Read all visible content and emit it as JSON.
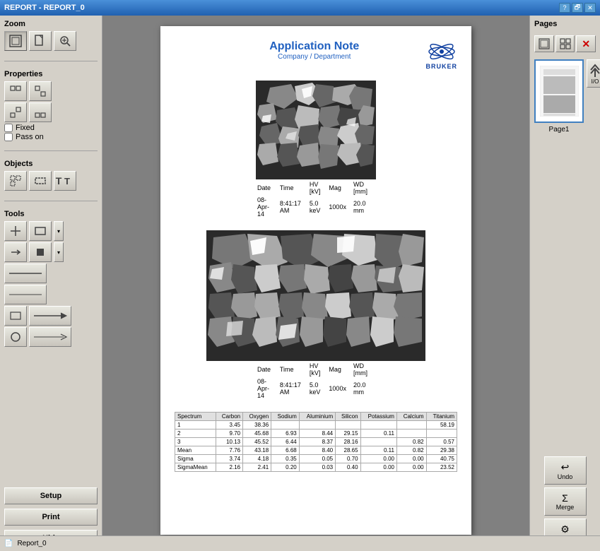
{
  "titleBar": {
    "title": "REPORT - REPORT_0",
    "helpBtn": "?",
    "restoreBtn": "🗗",
    "closeBtn": "✕"
  },
  "leftPanel": {
    "zoom": {
      "label": "Zoom",
      "buttons": [
        {
          "name": "zoom-fit",
          "icon": "⊡"
        },
        {
          "name": "zoom-page",
          "icon": "▣"
        },
        {
          "name": "zoom-in",
          "icon": "⊕"
        }
      ]
    },
    "properties": {
      "label": "Properties",
      "buttons": [
        {
          "name": "prop-1",
          "icon": "⊞"
        },
        {
          "name": "prop-2",
          "icon": "⊟"
        },
        {
          "name": "prop-3",
          "icon": "⊠"
        },
        {
          "name": "prop-4",
          "icon": "⊡"
        }
      ]
    },
    "fixed": {
      "label": "Fixed"
    },
    "passOn": {
      "label": "Pass on"
    },
    "objects": {
      "label": "Objects",
      "buttons": [
        {
          "name": "obj-select",
          "icon": "⊹"
        },
        {
          "name": "obj-rect",
          "icon": "▭"
        },
        {
          "name": "obj-text",
          "icon": "T"
        }
      ]
    },
    "tools": {
      "label": "Tools",
      "row1": [
        {
          "name": "tool-move",
          "icon": "✛"
        },
        {
          "name": "tool-rect",
          "icon": "▭"
        },
        {
          "name": "tool-dropdown1",
          "icon": "▾"
        }
      ],
      "row2": [
        {
          "name": "tool-arrow",
          "icon": "→"
        },
        {
          "name": "tool-dot",
          "icon": "■"
        },
        {
          "name": "tool-dropdown2",
          "icon": "▾"
        }
      ],
      "row3": [
        {
          "name": "tool-hline",
          "icon": "—"
        }
      ],
      "row4": [
        {
          "name": "tool-line1",
          "icon": "—"
        }
      ],
      "row5": [
        {
          "name": "tool-frame",
          "icon": "☐"
        },
        {
          "name": "tool-arrow2",
          "icon": "→"
        }
      ],
      "row6": [
        {
          "name": "tool-circle",
          "icon": "○"
        },
        {
          "name": "tool-arrow3",
          "icon": "→"
        }
      ]
    },
    "setupBtn": "Setup",
    "printBtn": "Print",
    "hideBtn": "Hide"
  },
  "document": {
    "header": {
      "title": "Application Note",
      "subtitle": "Company / Department",
      "logoText": "BRUKER"
    },
    "image1": {
      "meta": {
        "dateLabel": "Date",
        "timeLabel": "Time",
        "hvLabel": "HV\n[kV]",
        "magLabel": "Mag",
        "wdLabel": "WD\n[mm]",
        "dateVal": "08-Apr-14",
        "timeVal": "8:41:17 AM",
        "hvVal": "5.0 keV",
        "magVal": "1000x",
        "wdVal": "20.0 mm"
      }
    },
    "image2": {
      "meta": {
        "dateLabel": "Date",
        "timeLabel": "Time",
        "hvLabel": "HV\n[kV]",
        "magLabel": "Mag",
        "wdLabel": "WD\n[mm]",
        "dateVal": "08-Apr-14",
        "timeVal": "8:41:17 AM",
        "hvVal": "5.0 keV",
        "magVal": "1000x",
        "wdVal": "20.0 mm"
      }
    },
    "dataTable": {
      "headers": [
        "Spectrum",
        "Carbon",
        "Oxygen",
        "Sodium",
        "Aluminium",
        "Silicon",
        "Potassium",
        "Calcium",
        "Titanium"
      ],
      "rows": [
        [
          "1",
          "3.45",
          "38.36",
          "",
          "",
          "",
          "",
          "",
          "58.19"
        ],
        [
          "2",
          "9.70",
          "45.68",
          "6.93",
          "8.44",
          "29.15",
          "0.11",
          "",
          ""
        ],
        [
          "3",
          "10.13",
          "45.52",
          "6.44",
          "8.37",
          "28.16",
          "",
          "0.82",
          "0.57"
        ],
        [
          "Mean",
          "7.76",
          "43.18",
          "6.68",
          "8.40",
          "28.65",
          "0.11",
          "0.82",
          "29.38"
        ],
        [
          "Sigma",
          "3.74",
          "4.18",
          "0.35",
          "0.05",
          "0.70",
          "0.00",
          "0.00",
          "40.75"
        ],
        [
          "SigmaMean",
          "2.16",
          "2.41",
          "0.20",
          "0.03",
          "0.40",
          "0.00",
          "0.00",
          "23.52"
        ]
      ]
    }
  },
  "rightPanel": {
    "pagesLabel": "Pages",
    "pageThumb": "Page1",
    "ioLabel": "I/O",
    "undoLabel": "Undo",
    "mergeLabel": "Merge",
    "optionsLabel": "Options"
  },
  "statusBar": {
    "fileLabel": "Report_0"
  }
}
